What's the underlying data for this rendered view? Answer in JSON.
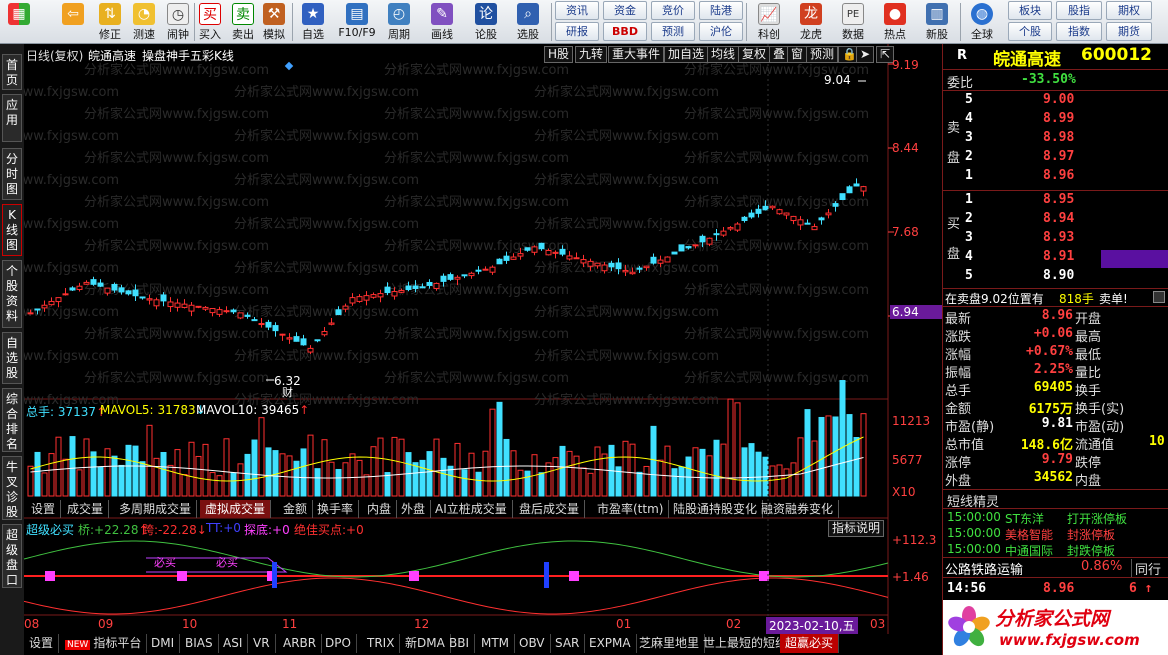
{
  "toolbar": {
    "items": [
      {
        "label": "",
        "icon": "grid-icon"
      },
      {
        "label": "",
        "icon": "back-icon"
      },
      {
        "label": "修正",
        "icon": "updown-icon"
      },
      {
        "label": "测速",
        "icon": "speed-icon"
      },
      {
        "label": "闹钟",
        "icon": "clock-icon"
      },
      {
        "label": "买入",
        "icon": "buy-icon"
      },
      {
        "label": "卖出",
        "icon": "sell-icon"
      },
      {
        "label": "模拟",
        "icon": "hammer-icon"
      },
      {
        "label": "自选",
        "icon": "star-icon"
      },
      {
        "label": "F10/F9",
        "icon": "f10-icon"
      },
      {
        "label": "周期",
        "icon": "clock-cycle-icon"
      },
      {
        "label": "画线",
        "icon": "pencil-icon"
      },
      {
        "label": "论股",
        "icon": "discuss-icon"
      },
      {
        "label": "选股",
        "icon": "magnifier-icon"
      }
    ],
    "small_buttons": [
      [
        "资讯",
        "资金",
        "竞价",
        "陆港"
      ],
      [
        "研报",
        "BBD",
        "预测",
        "沪伦"
      ]
    ],
    "right_items": [
      {
        "label": "科创",
        "icon": "chart-icon"
      },
      {
        "label": "龙虎",
        "icon": "dragon-icon"
      },
      {
        "label": "数据",
        "icon": "pe-icon"
      },
      {
        "label": "热点",
        "icon": "hot-icon"
      },
      {
        "label": "新股",
        "icon": "newstock-icon"
      },
      {
        "label": "全球",
        "icon": "globe-icon"
      }
    ],
    "far_right": [
      [
        "板块",
        "股指",
        "期权"
      ],
      [
        "个股",
        "指数",
        "期货"
      ]
    ]
  },
  "left_tabs": [
    "首页",
    "应用",
    "分时图",
    "K线图",
    "个股资料",
    "自选股",
    "综合排名",
    "牛叉诊股",
    "超级盘口"
  ],
  "chart_header": {
    "title": "日线(复权)",
    "stock": "皖通高速",
    "formula": "操盘神手五彩K线",
    "controls": [
      "H股",
      "九转",
      "重大事件",
      "加自选",
      "均线",
      "复权",
      "叠",
      "窗",
      "预测"
    ]
  },
  "price_axis": [
    "9.19",
    "8.44",
    "7.68",
    "6.94"
  ],
  "annotations": {
    "high": "9.04",
    "low": "6.32",
    "cai": "财"
  },
  "watermark": "分析家公式网www.fxjgsw.com",
  "volume": {
    "title": "总手",
    "value": "37137",
    "ma5_label": "MAVOL5:",
    "ma5": "31783",
    "ma10_label": "MAVOL10:",
    "ma10": "39465",
    "axis": [
      "11213",
      "5677",
      "X10"
    ]
  },
  "panel_tabs": [
    "设置",
    "成交量",
    "多周期成交量",
    "虚拟成交量",
    "金额",
    "换手率",
    "内盘",
    "外盘",
    "AI立桩成交量",
    "盘后成交量",
    "市盈率(ttm)",
    "陆股通持股变化",
    "融资融券变化"
  ],
  "indicator": {
    "name": "超级必买",
    "bridge_label": "桥:",
    "bridge": "+22.28",
    "cross_label": "跨:",
    "cross": "-22.28",
    "tt_label": "TT:",
    "tt": "+0",
    "probe_label": "探底:",
    "probe": "+0",
    "buy_label": "绝佳买点:",
    "buy": "+0",
    "explain": "指标说明",
    "axis": [
      "+112.3",
      "+1.46"
    ],
    "marks": [
      "必买",
      "必买"
    ]
  },
  "date_axis": [
    "08",
    "09",
    "10",
    "11",
    "12",
    "01",
    "02",
    "03"
  ],
  "cursor_date": "2023-02-10,五",
  "bottom_tabs": [
    "设置",
    "指标平台",
    "DMI",
    "BIAS",
    "ASI",
    "VR",
    "ARBR",
    "DPO",
    "TRIX",
    "新DMA",
    "BBI",
    "MTM",
    "OBV",
    "SAR",
    "EXPMA",
    "芝麻里地里",
    "世上最短的短线",
    "超赢必买"
  ],
  "new_badge": "NEW",
  "quote": {
    "r_label": "R",
    "name": "皖通高速",
    "code": "600012",
    "weibi_label": "委比",
    "weibi": "-33.50%",
    "sell_label": "卖盘",
    "buy_label": "买盘",
    "sell": [
      {
        "level": "5",
        "price": "9.00"
      },
      {
        "level": "4",
        "price": "8.99"
      },
      {
        "level": "3",
        "price": "8.98"
      },
      {
        "level": "2",
        "price": "8.97"
      },
      {
        "level": "1",
        "price": "8.96"
      }
    ],
    "buy": [
      {
        "level": "1",
        "price": "8.95"
      },
      {
        "level": "2",
        "price": "8.94"
      },
      {
        "level": "3",
        "price": "8.93"
      },
      {
        "level": "4",
        "price": "8.91"
      },
      {
        "level": "5",
        "price": "8.90"
      }
    ],
    "sell_position": "在卖盘9.02位置有",
    "sell_position_vol": "818手",
    "sell_single": "卖单!",
    "stats": [
      {
        "l1": "最新",
        "v1": "8.96",
        "l2": "开盘",
        "v2": ""
      },
      {
        "l1": "涨跌",
        "v1": "+0.06",
        "l2": "最高",
        "v2": ""
      },
      {
        "l1": "涨幅",
        "v1": "+0.67%",
        "l2": "最低",
        "v2": ""
      },
      {
        "l1": "振幅",
        "v1": "2.25%",
        "l2": "量比",
        "v2": ""
      },
      {
        "l1": "总手",
        "v1": "69405",
        "l2": "换手",
        "v2": ""
      },
      {
        "l1": "金额",
        "v1": "6175万",
        "l2": "换手(实)",
        "v2": ""
      },
      {
        "l1": "市盈(静)",
        "v1": "9.81",
        "l2": "市盈(动)",
        "v2": ""
      },
      {
        "l1": "总市值",
        "v1": "148.6亿",
        "l2": "流通值",
        "v2": "10"
      },
      {
        "l1": "涨停",
        "v1": "9.79",
        "l2": "跌停",
        "v2": ""
      },
      {
        "l1": "外盘",
        "v1": "34562",
        "l2": "内盘",
        "v2": ""
      }
    ],
    "short_title": "短线精灵",
    "short_items": [
      {
        "time": "15:00:00",
        "name": "ST东洋",
        "event": "打开涨停板"
      },
      {
        "time": "15:00:00",
        "name": "美格智能",
        "event": "封涨停板"
      },
      {
        "time": "15:00:00",
        "name": "中通国际",
        "event": "封跌停板"
      }
    ],
    "sector_name": "公路铁路运输",
    "sector_chg": "0.86%",
    "sector_tab": "同行",
    "tick_time": "14:56",
    "tick_price": "8.96",
    "tick_vol": "6",
    "logo_text": "分析家公式网",
    "logo_url": "www.fxjgsw.com"
  },
  "colors": {
    "up": "#ff3030",
    "down": "#40e0ff",
    "accent": "#ffff00",
    "bg": "#000000"
  }
}
